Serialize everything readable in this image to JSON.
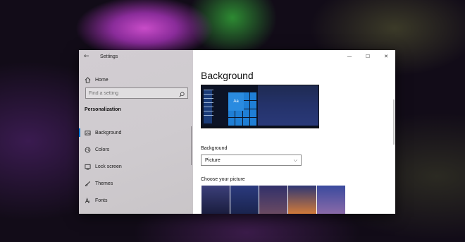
{
  "window": {
    "title": "Settings",
    "controls": {
      "minimize": "—",
      "maximize": "☐",
      "close": "✕"
    }
  },
  "sidebar": {
    "home_label": "Home",
    "search_placeholder": "Find a setting",
    "section_title": "Personalization",
    "items": [
      {
        "label": "Background",
        "icon": "image-icon",
        "active": true
      },
      {
        "label": "Colors",
        "icon": "palette-icon",
        "active": false
      },
      {
        "label": "Lock screen",
        "icon": "lock-screen-icon",
        "active": false
      },
      {
        "label": "Themes",
        "icon": "brush-icon",
        "active": false
      },
      {
        "label": "Fonts",
        "icon": "font-icon",
        "active": false
      }
    ]
  },
  "main": {
    "page_title": "Background",
    "preview_tile_text": "Aa",
    "background_label": "Background",
    "background_value": "Picture",
    "choose_label": "Choose your picture",
    "thumbnails": [
      {
        "top": "#3b3f7a",
        "bottom": "#1a1d3e"
      },
      {
        "top": "#2b3a7e",
        "bottom": "#1a244e"
      },
      {
        "top": "#31306a",
        "bottom": "#6a4a62"
      },
      {
        "top": "#2f3774",
        "bottom": "#d07a3a"
      },
      {
        "top": "#3a4a9e",
        "bottom": "#8a6aa8"
      }
    ]
  },
  "colors": {
    "accent": "#0078d7"
  }
}
